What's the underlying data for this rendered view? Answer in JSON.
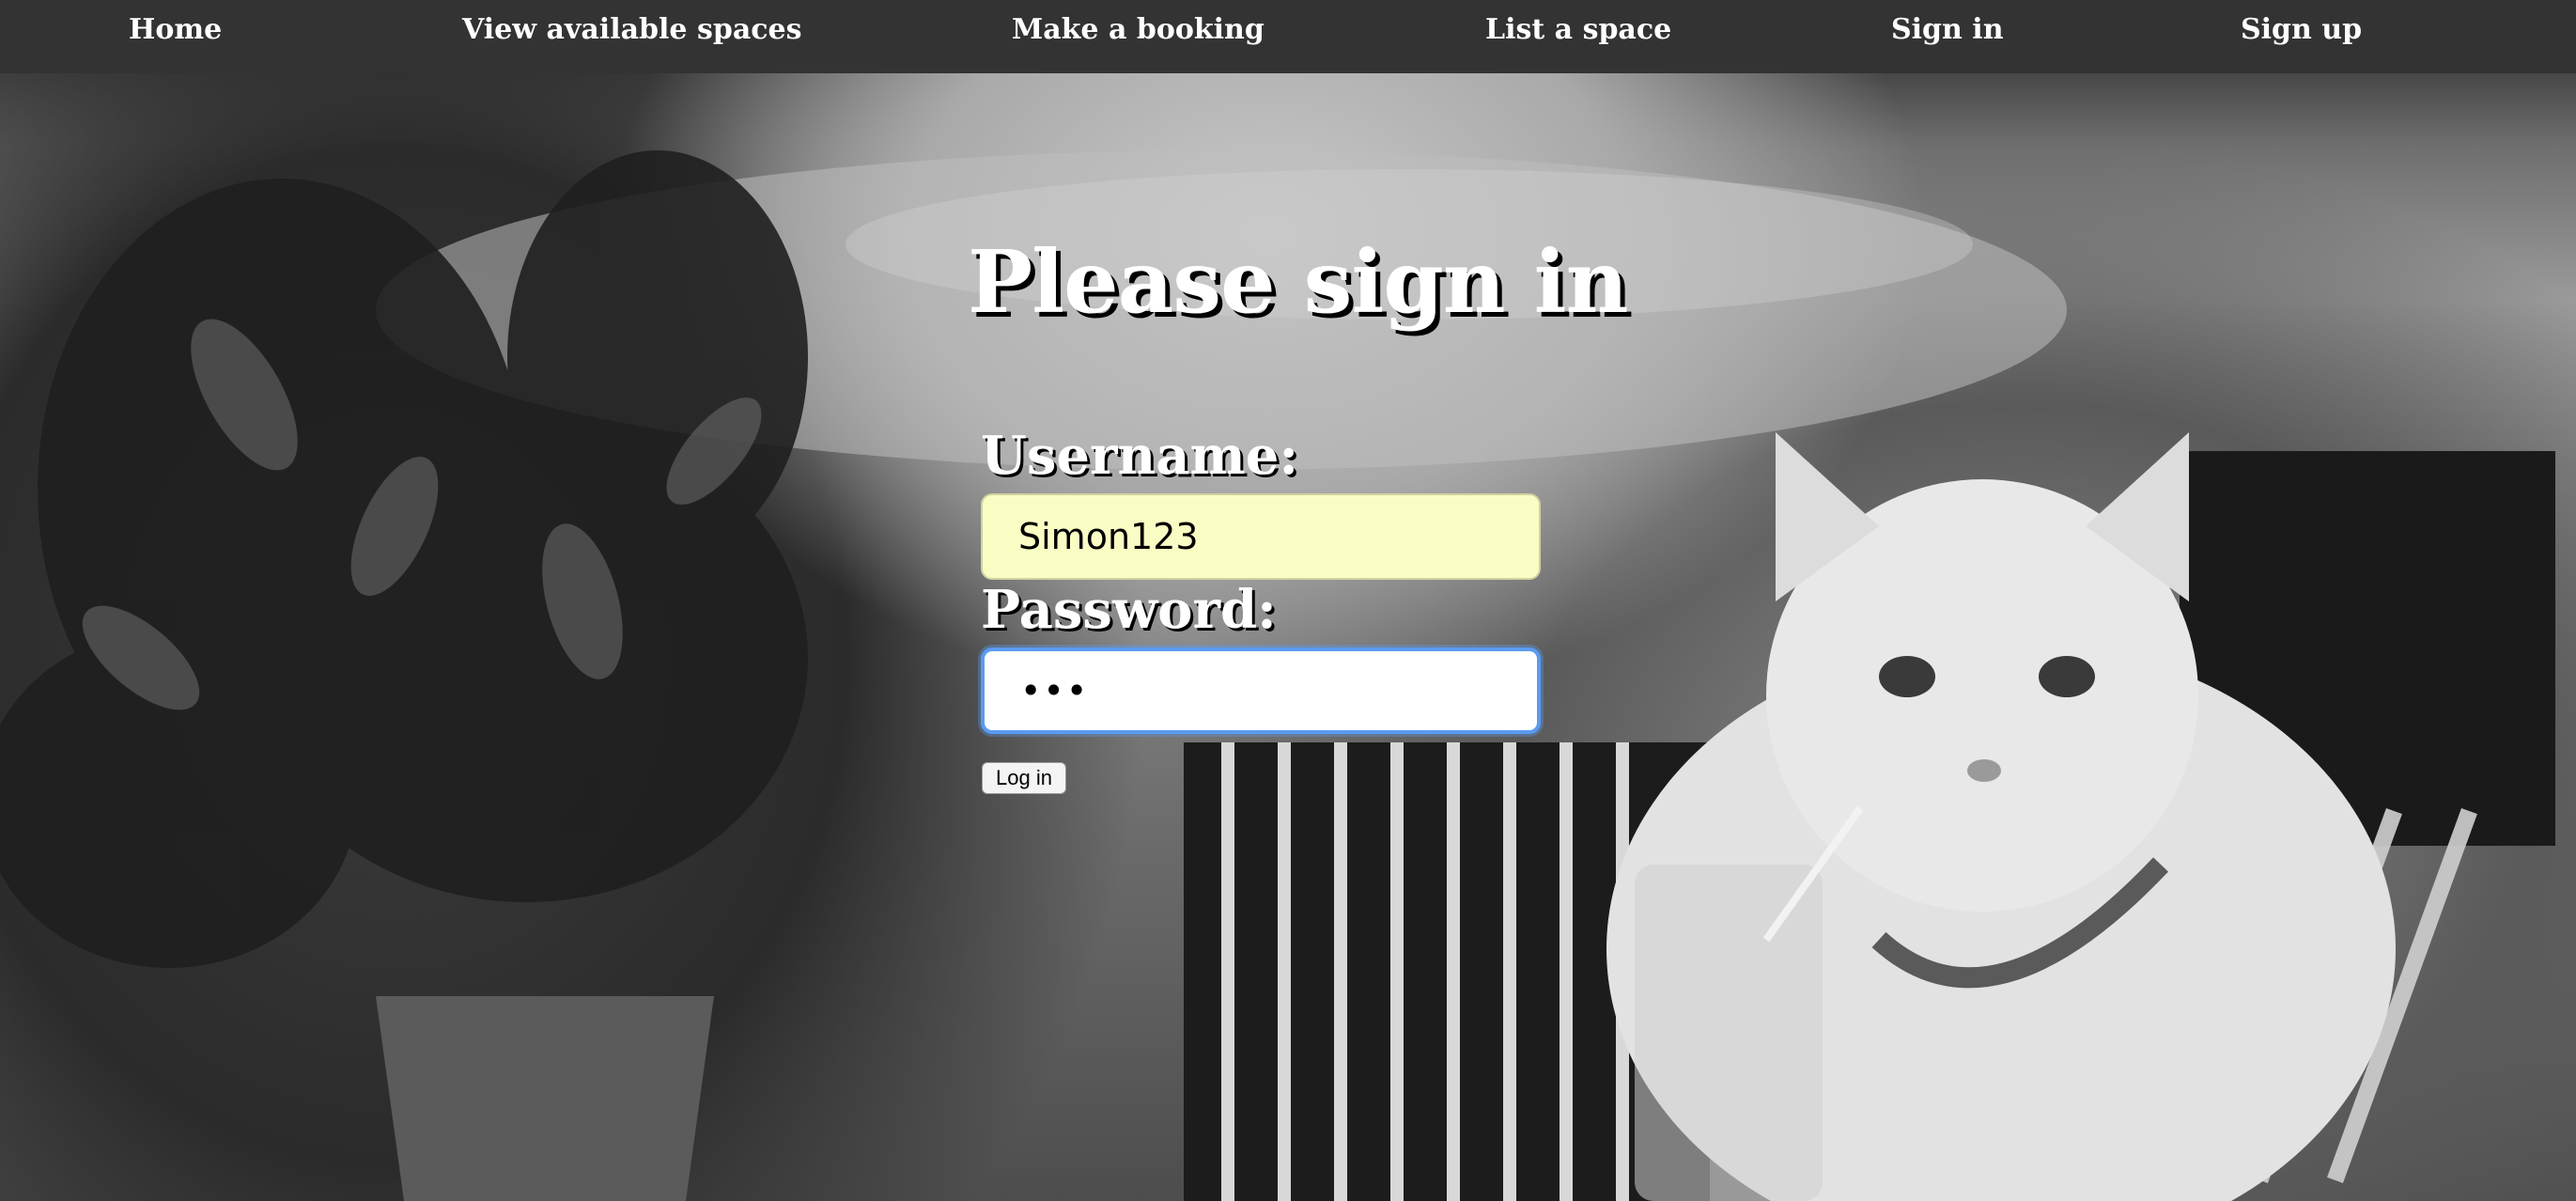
{
  "nav": {
    "items": [
      {
        "label": "Home"
      },
      {
        "label": "View available spaces"
      },
      {
        "label": "Make a booking"
      },
      {
        "label": "List a space"
      },
      {
        "label": "Sign in"
      },
      {
        "label": "Sign up"
      }
    ]
  },
  "signin": {
    "title": "Please sign in",
    "username_label": "Username:",
    "username_value": "Simon123",
    "password_label": "Password:",
    "password_value": "•••",
    "login_label": "Log in"
  },
  "colors": {
    "navbar_bg": "#333333",
    "username_field_bg": "#fafdc3",
    "focus_ring": "#5b9bf0"
  },
  "background": {
    "icon": "grayscale-photo-cat-with-plant"
  }
}
